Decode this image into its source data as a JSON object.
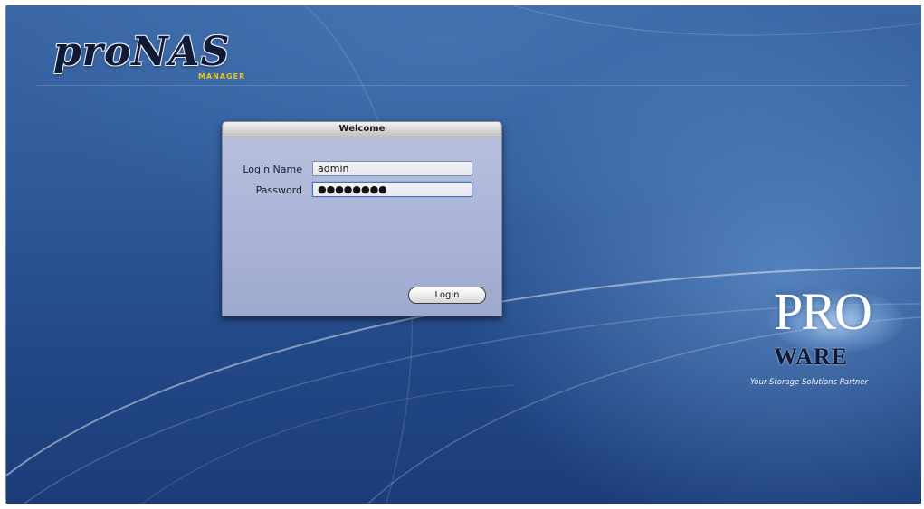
{
  "app": {
    "brand_name": "proNAS",
    "brand_sub": "MANAGER"
  },
  "login_dialog": {
    "title": "Welcome",
    "login_name_label": "Login Name",
    "login_name_value": "admin",
    "password_label": "Password",
    "password_value": "●●●●●●●●",
    "login_button_label": "Login"
  },
  "partner_logo": {
    "top": "PRO",
    "bottom": "WARE",
    "tagline": "Your Storage Solutions Partner"
  },
  "colors": {
    "background": "#2f5b9b",
    "dialog_background": "#a9b3d6",
    "brand_sub": "#f0c419"
  }
}
